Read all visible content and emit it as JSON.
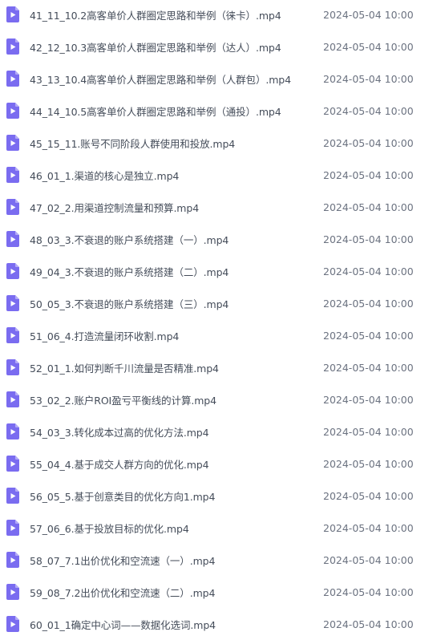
{
  "files": [
    {
      "name": "41_11_10.2高客单价人群圈定思路和举例（徕卡）.mp4",
      "time": "2024-05-04 10:00"
    },
    {
      "name": "42_12_10.3高客单价人群圈定思路和举例（达人）.mp4",
      "time": "2024-05-04 10:00"
    },
    {
      "name": "43_13_10.4高客单价人群圈定思路和举例（人群包）.mp4",
      "time": "2024-05-04 10:00"
    },
    {
      "name": "44_14_10.5高客单价人群圈定思路和举例（通投）.mp4",
      "time": "2024-05-04 10:00"
    },
    {
      "name": "45_15_11.账号不同阶段人群使用和投放.mp4",
      "time": "2024-05-04 10:00"
    },
    {
      "name": "46_01_1.渠道的核心是独立.mp4",
      "time": "2024-05-04 10:00"
    },
    {
      "name": "47_02_2.用渠道控制流量和预算.mp4",
      "time": "2024-05-04 10:00"
    },
    {
      "name": "48_03_3.不衰退的账户系统搭建（一）.mp4",
      "time": "2024-05-04 10:00"
    },
    {
      "name": "49_04_3.不衰退的账户系统搭建（二）.mp4",
      "time": "2024-05-04 10:00"
    },
    {
      "name": "50_05_3.不衰退的账户系统搭建（三）.mp4",
      "time": "2024-05-04 10:00"
    },
    {
      "name": "51_06_4.打造流量闭环收割.mp4",
      "time": "2024-05-04 10:00"
    },
    {
      "name": "52_01_1.如何判断千川流量是否精准.mp4",
      "time": "2024-05-04 10:00"
    },
    {
      "name": "53_02_2.账户ROI盈亏平衡线的计算.mp4",
      "time": "2024-05-04 10:00"
    },
    {
      "name": "54_03_3.转化成本过高的优化方法.mp4",
      "time": "2024-05-04 10:00"
    },
    {
      "name": "55_04_4.基于成交人群方向的优化.mp4",
      "time": "2024-05-04 10:00"
    },
    {
      "name": "56_05_5.基于创意类目的优化方向1.mp4",
      "time": "2024-05-04 10:00"
    },
    {
      "name": "57_06_6.基于投放目标的优化.mp4",
      "time": "2024-05-04 10:00"
    },
    {
      "name": "58_07_7.1出价优化和空流速（一）.mp4",
      "time": "2024-05-04 10:00"
    },
    {
      "name": "59_08_7.2出价优化和空流速（二）.mp4",
      "time": "2024-05-04 10:00"
    },
    {
      "name": "60_01_1确定中心词——数据化选词.mp4",
      "time": "2024-05-04 10:00"
    }
  ],
  "icons": {
    "file_icon": "video-file-icon",
    "icon_color": "#7a6cf0"
  }
}
